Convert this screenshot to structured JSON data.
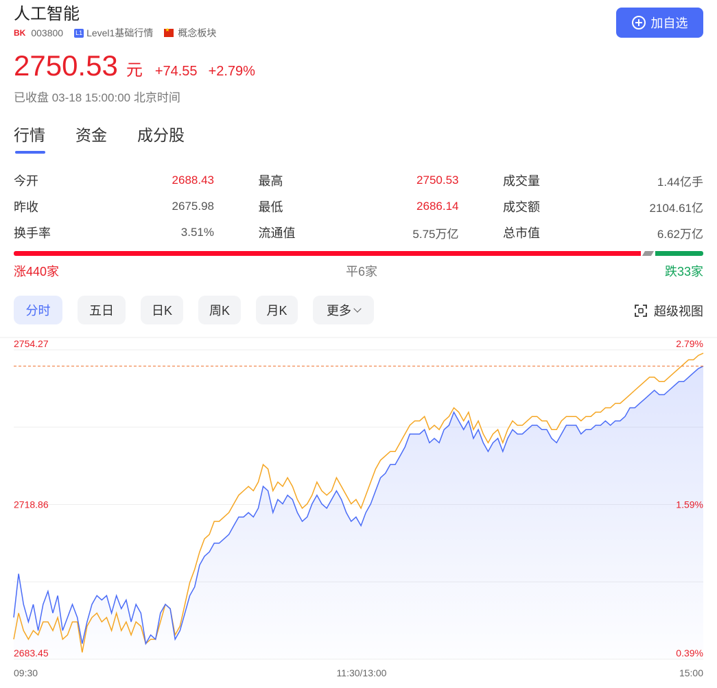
{
  "header": {
    "title": "人工智能",
    "bk_badge": "BK",
    "code": "003800",
    "l1_badge": "L1",
    "level_text": "Level1基础行情",
    "concept_text": "概念板块"
  },
  "add_button": {
    "label": "加自选"
  },
  "quote": {
    "price": "2750.53",
    "unit": "元",
    "change": "+74.55",
    "change_pct": "+2.79%",
    "status": "已收盘 03-18 15:00:00 北京时间"
  },
  "tabs": [
    {
      "label": "行情"
    },
    {
      "label": "资金"
    },
    {
      "label": "成分股"
    }
  ],
  "stats": [
    {
      "label": "今开",
      "value": "2688.43",
      "color": "red"
    },
    {
      "label": "最高",
      "value": "2750.53",
      "color": "red"
    },
    {
      "label": "成交量",
      "value": "1.44亿手",
      "color": "normal"
    },
    {
      "label": "昨收",
      "value": "2675.98",
      "color": "normal"
    },
    {
      "label": "最低",
      "value": "2686.14",
      "color": "red"
    },
    {
      "label": "成交额",
      "value": "2104.61亿",
      "color": "normal"
    },
    {
      "label": "换手率",
      "value": "3.51%",
      "color": "normal"
    },
    {
      "label": "流通值",
      "value": "5.75万亿",
      "color": "normal"
    },
    {
      "label": "总市值",
      "value": "6.62万亿",
      "color": "normal"
    }
  ],
  "breadth": {
    "up_count": 440,
    "flat_count": 6,
    "down_count": 33,
    "up_label": "涨440家",
    "flat_label": "平6家",
    "down_label": "跌33家"
  },
  "period_tabs": [
    {
      "label": "分时",
      "active": true
    },
    {
      "label": "五日",
      "active": false
    },
    {
      "label": "日K",
      "active": false
    },
    {
      "label": "周K",
      "active": false
    },
    {
      "label": "月K",
      "active": false
    },
    {
      "label": "更多",
      "active": false
    }
  ],
  "super_view": {
    "label": "超级视图",
    "icon": "focus-frame-icon"
  },
  "colors": {
    "up": "#e8202a",
    "down": "#12a45a",
    "accent": "#4a6cf7",
    "price_line": "#4a6cf7",
    "avg_line": "#f5a623",
    "ref_line": "#f07c3c"
  },
  "chart_data": {
    "type": "line",
    "y_left_ticks": [
      "2754.27",
      "2718.86",
      "2683.45"
    ],
    "y_right_ticks": [
      "2.79%",
      "1.59%",
      "0.39%"
    ],
    "x_ticks": [
      "09:30",
      "11:30/13:00",
      "15:00"
    ],
    "ylim": [
      2683.45,
      2754.27
    ],
    "reference_value": 2750.53,
    "series": [
      {
        "values": [
          2693,
          2703,
          2696,
          2692,
          2696,
          2690,
          2696,
          2699,
          2694,
          2698,
          2690,
          2693,
          2696,
          2693,
          2687,
          2692,
          2696,
          2698,
          2697,
          2698,
          2694,
          2698,
          2695,
          2697,
          2692,
          2696,
          2694,
          2687,
          2689,
          2688,
          2694,
          2696,
          2695,
          2688,
          2690,
          2694,
          2698,
          2700,
          2705,
          2707,
          2708,
          2710,
          2710,
          2711,
          2712,
          2714,
          2716,
          2716,
          2717,
          2716,
          2718,
          2723,
          2722,
          2717,
          2720,
          2719,
          2721,
          2720,
          2717,
          2715,
          2716,
          2719,
          2721,
          2719,
          2718,
          2720,
          2722,
          2720,
          2717,
          2715,
          2716,
          2714,
          2717,
          2719,
          2722,
          2725,
          2726,
          2728,
          2728,
          2730,
          2732,
          2735,
          2735,
          2735,
          2736,
          2733,
          2734,
          2733,
          2736,
          2737,
          2740,
          2738,
          2736,
          2738,
          2734,
          2736,
          2733,
          2731,
          2733,
          2734,
          2731,
          2734,
          2736,
          2735,
          2735,
          2736,
          2737,
          2737,
          2736,
          2736,
          2734,
          2733,
          2735,
          2737,
          2737,
          2737,
          2735,
          2736,
          2736,
          2737,
          2737,
          2738,
          2737,
          2738,
          2738,
          2739,
          2741,
          2741,
          2742,
          2743,
          2744,
          2745,
          2744,
          2744,
          2745,
          2746,
          2747,
          2747,
          2748,
          2749,
          2750,
          2750.53
        ]
      },
      {
        "values": [
          2688,
          2694,
          2690,
          2688,
          2690,
          2689,
          2692,
          2692,
          2690,
          2693,
          2688,
          2689,
          2692,
          2692,
          2685,
          2691,
          2693,
          2694,
          2692,
          2693,
          2690,
          2694,
          2690,
          2692,
          2689,
          2692,
          2691,
          2687,
          2688,
          2688,
          2692,
          2696,
          2695,
          2689,
          2691,
          2696,
          2701,
          2704,
          2708,
          2711,
          2712,
          2715,
          2715,
          2716,
          2717,
          2719,
          2721,
          2722,
          2723,
          2722,
          2724,
          2728,
          2727,
          2722,
          2724,
          2723,
          2725,
          2723,
          2720,
          2718,
          2719,
          2721,
          2724,
          2722,
          2721,
          2722,
          2725,
          2723,
          2721,
          2719,
          2720,
          2718,
          2721,
          2724,
          2727,
          2729,
          2730,
          2731,
          2731,
          2733,
          2735,
          2737,
          2738,
          2738,
          2739,
          2736,
          2737,
          2736,
          2738,
          2739,
          2741,
          2740,
          2738,
          2740,
          2736,
          2738,
          2735,
          2733,
          2735,
          2736,
          2733,
          2736,
          2738,
          2737,
          2737,
          2738,
          2739,
          2739,
          2738,
          2738,
          2736,
          2736,
          2738,
          2739,
          2739,
          2739,
          2738,
          2739,
          2739,
          2740,
          2740,
          2741,
          2741,
          2742,
          2742,
          2743,
          2744,
          2745,
          2746,
          2747,
          2748,
          2748,
          2747,
          2747,
          2748,
          2749,
          2750,
          2751,
          2752,
          2752,
          2753,
          2753.5
        ]
      }
    ]
  }
}
